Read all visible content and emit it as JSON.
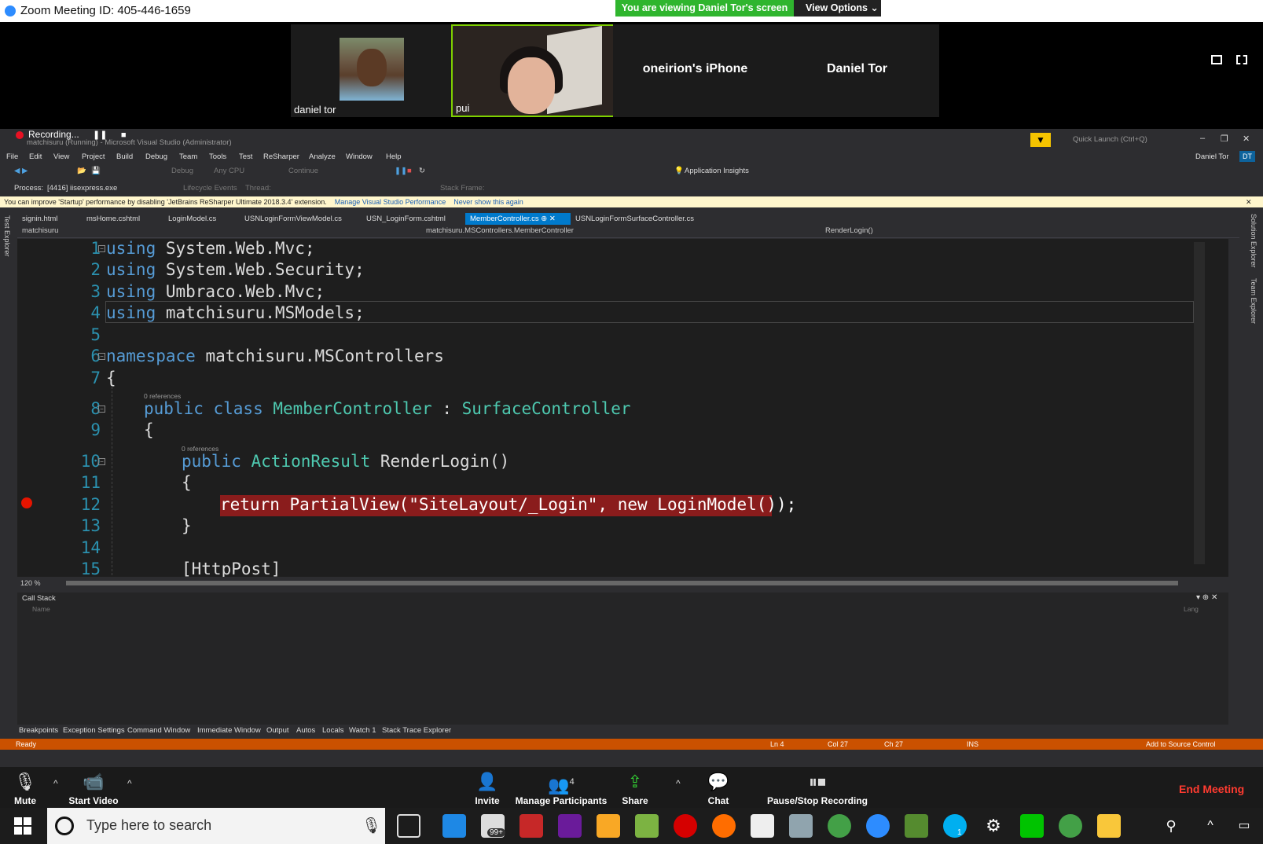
{
  "zoom": {
    "title": "Zoom Meeting ID: 405-446-1659",
    "viewing_banner": "You are viewing Daniel Tor's screen",
    "view_options": "View Options ⌄",
    "participants": [
      {
        "name": "daniel tor"
      },
      {
        "name": "pui"
      },
      {
        "name": "oneirion's iPhone"
      },
      {
        "name": "Daniel Tor"
      }
    ],
    "controls": {
      "mute": "Mute",
      "start_video": "Start Video",
      "invite": "Invite",
      "manage_participants": "Manage Participants",
      "participant_count": "4",
      "share": "Share",
      "chat": "Chat",
      "pause_stop_recording": "Pause/Stop Recording",
      "end_meeting": "End Meeting"
    },
    "recording_label": "Recording..."
  },
  "vs": {
    "window_title": "matchisuru (Running) - Microsoft Visual Studio (Administrator)",
    "quick_launch": "Quick Launch (Ctrl+Q)",
    "user": "Daniel Tor",
    "user_initials": "DT",
    "menu": [
      "File",
      "Edit",
      "View",
      "Project",
      "Build",
      "Debug",
      "Team",
      "Tools",
      "Test",
      "ReSharper",
      "Analyze",
      "Window",
      "Help"
    ],
    "toolbar": {
      "config": "Debug",
      "platform": "Any CPU",
      "continue": "Continue",
      "app_insights": "Application Insights",
      "process_label": "Process:",
      "process_value": "[4416] iisexpress.exe",
      "lifecycle": "Lifecycle Events",
      "thread": "Thread:",
      "stack_frame": "Stack Frame:"
    },
    "info_bar": {
      "message": "You can improve 'Startup' performance by disabling 'JetBrains ReSharper Ultimate 2018.3.4' extension.",
      "link1": "Manage Visual Studio Performance",
      "link2": "Never show this again"
    },
    "left_rail": "Test Explorer",
    "right_rail": [
      "Solution Explorer",
      "Team Explorer"
    ],
    "tabs": [
      "signin.html",
      "msHome.cshtml",
      "LoginModel.cs",
      "USNLoginFormViewModel.cs",
      "USN_LoginForm.cshtml",
      "MemberController.cs",
      "USNLoginFormSurfaceController.cs"
    ],
    "active_tab": "MemberController.cs",
    "nav": {
      "project": "matchisuru",
      "class": "matchisuru.MSControllers.MemberController",
      "member": "RenderLogin()"
    },
    "code": {
      "line_numbers": [
        "1",
        "2",
        "3",
        "4",
        "5",
        "6",
        "7",
        "8",
        "9",
        "10",
        "11",
        "12",
        "13",
        "14",
        "15"
      ],
      "l1_kw": "using",
      "l1_rest": " System.Web.Mvc;",
      "l2_kw": "using",
      "l2_rest": " System.Web.Security;",
      "l3_kw": "using",
      "l3_rest": " Umbraco.Web.Mvc;",
      "l4_kw": "using",
      "l4_rest": " matchisuru.MSModels;",
      "l6_kw": "namespace",
      "l6_rest": " matchisuru.MSControllers",
      "brace_open": "{",
      "brace_close": "}",
      "refs": "0 references",
      "l8_kw": "public class ",
      "l8_type": "MemberController",
      "l8_sep": " : ",
      "l8_base": "SurfaceController",
      "l10_kw": "public ",
      "l10_type": "ActionResult",
      "l10_rest": " RenderLogin()",
      "l12": "return PartialView(\"SiteLayout/_Login\", new LoginModel());",
      "l15": "[HttpPost]"
    },
    "zoom_level": "120 %",
    "call_stack": {
      "title": "Call Stack",
      "col_name": "Name",
      "col_lang": "Lang"
    },
    "bottom_tabs": [
      "Breakpoints",
      "Exception Settings",
      "Command Window",
      "Immediate Window",
      "Output",
      "Autos",
      "Locals",
      "Watch 1",
      "Stack Trace Explorer"
    ],
    "status": {
      "ready": "Ready",
      "ln": "Ln 4",
      "col": "Col 27",
      "ch": "Ch 27",
      "ins": "INS",
      "source_control": "Add to Source Control"
    }
  },
  "taskbar": {
    "search_placeholder": "Type here to search",
    "mail_badge": "99+",
    "skype_badge": "1"
  }
}
